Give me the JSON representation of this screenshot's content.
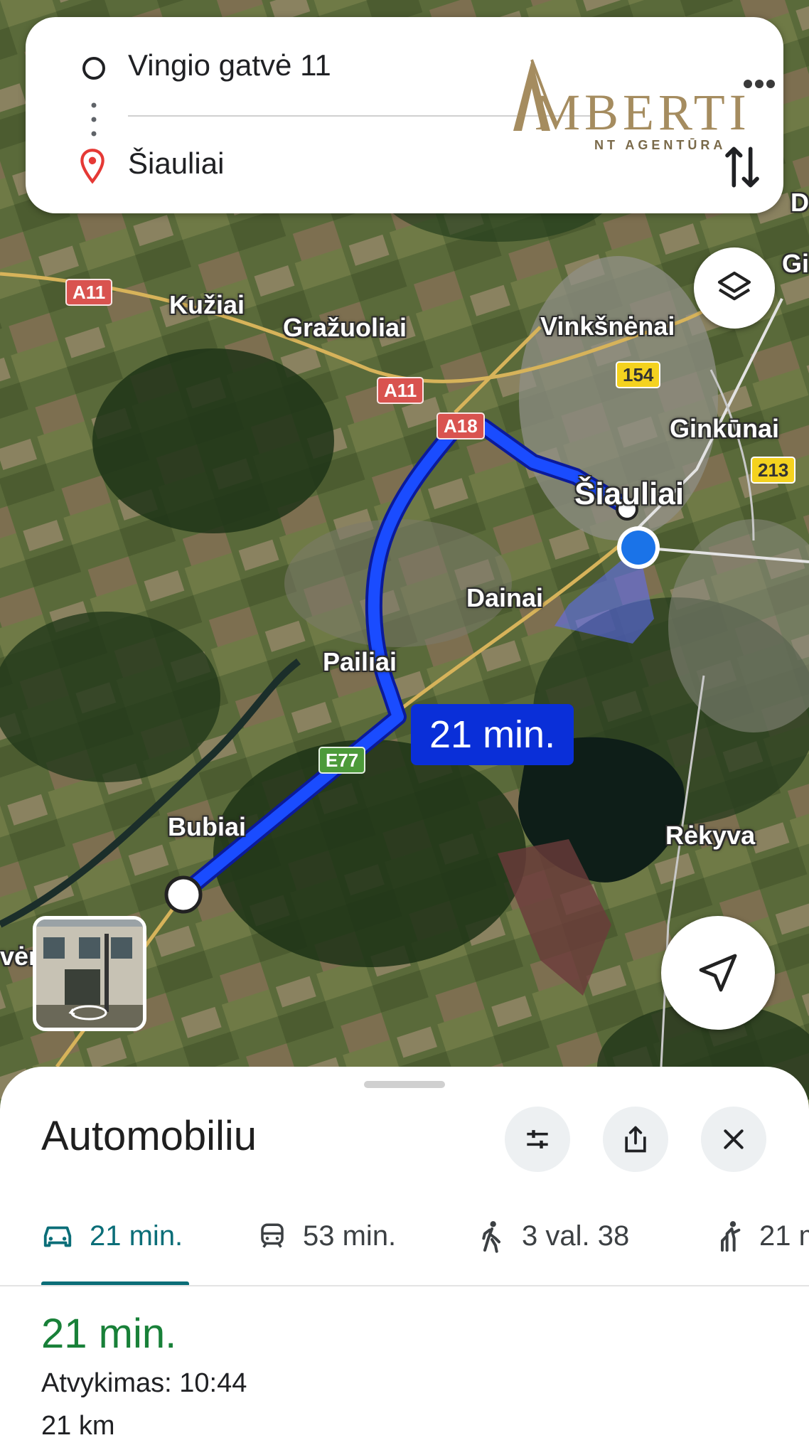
{
  "route": {
    "origin": "Vingio gatvė 11",
    "destination": "Šiauliai"
  },
  "logo": {
    "name": "AMBERTI",
    "tagline": "NT AGENTŪRA"
  },
  "map": {
    "places": {
      "kuziai": "Kužiai",
      "grazuoliai": "Gražuoliai",
      "vinksnenai": "Vinkšnėnai",
      "ginkunai": "Ginkūnai",
      "siauliai": "Šiauliai",
      "dainai": "Dainai",
      "pailiai": "Pailiai",
      "bubiai": "Bubiai",
      "rekyva": "Rėkyva",
      "edge_left": "vėn",
      "edge_right_top": "D",
      "edge_right_2": "Gi"
    },
    "shields": {
      "a11_left": "A11",
      "a11_mid": "A11",
      "a18": "A18",
      "e77": "E77",
      "r154": "154",
      "r213": "213"
    },
    "route_duration": "21 min.",
    "route_color": "#0a2fd8"
  },
  "sheet": {
    "title": "Automobiliu",
    "modes": [
      {
        "icon": "car-icon",
        "label": "21 min.",
        "active": true
      },
      {
        "icon": "transit-icon",
        "label": "53 min.",
        "active": false
      },
      {
        "icon": "walk-icon",
        "label": "3 val. 38",
        "active": false
      },
      {
        "icon": "ride-icon",
        "label": "21 m",
        "active": false
      }
    ],
    "summary": {
      "time": "21 min.",
      "arrival": "Atvykimas: 10:44",
      "distance": "21 km"
    }
  },
  "colors": {
    "accent": "#0b6e78",
    "time_green": "#188038",
    "pin_red": "#e53935",
    "logo_gold": "#a58c5f"
  }
}
